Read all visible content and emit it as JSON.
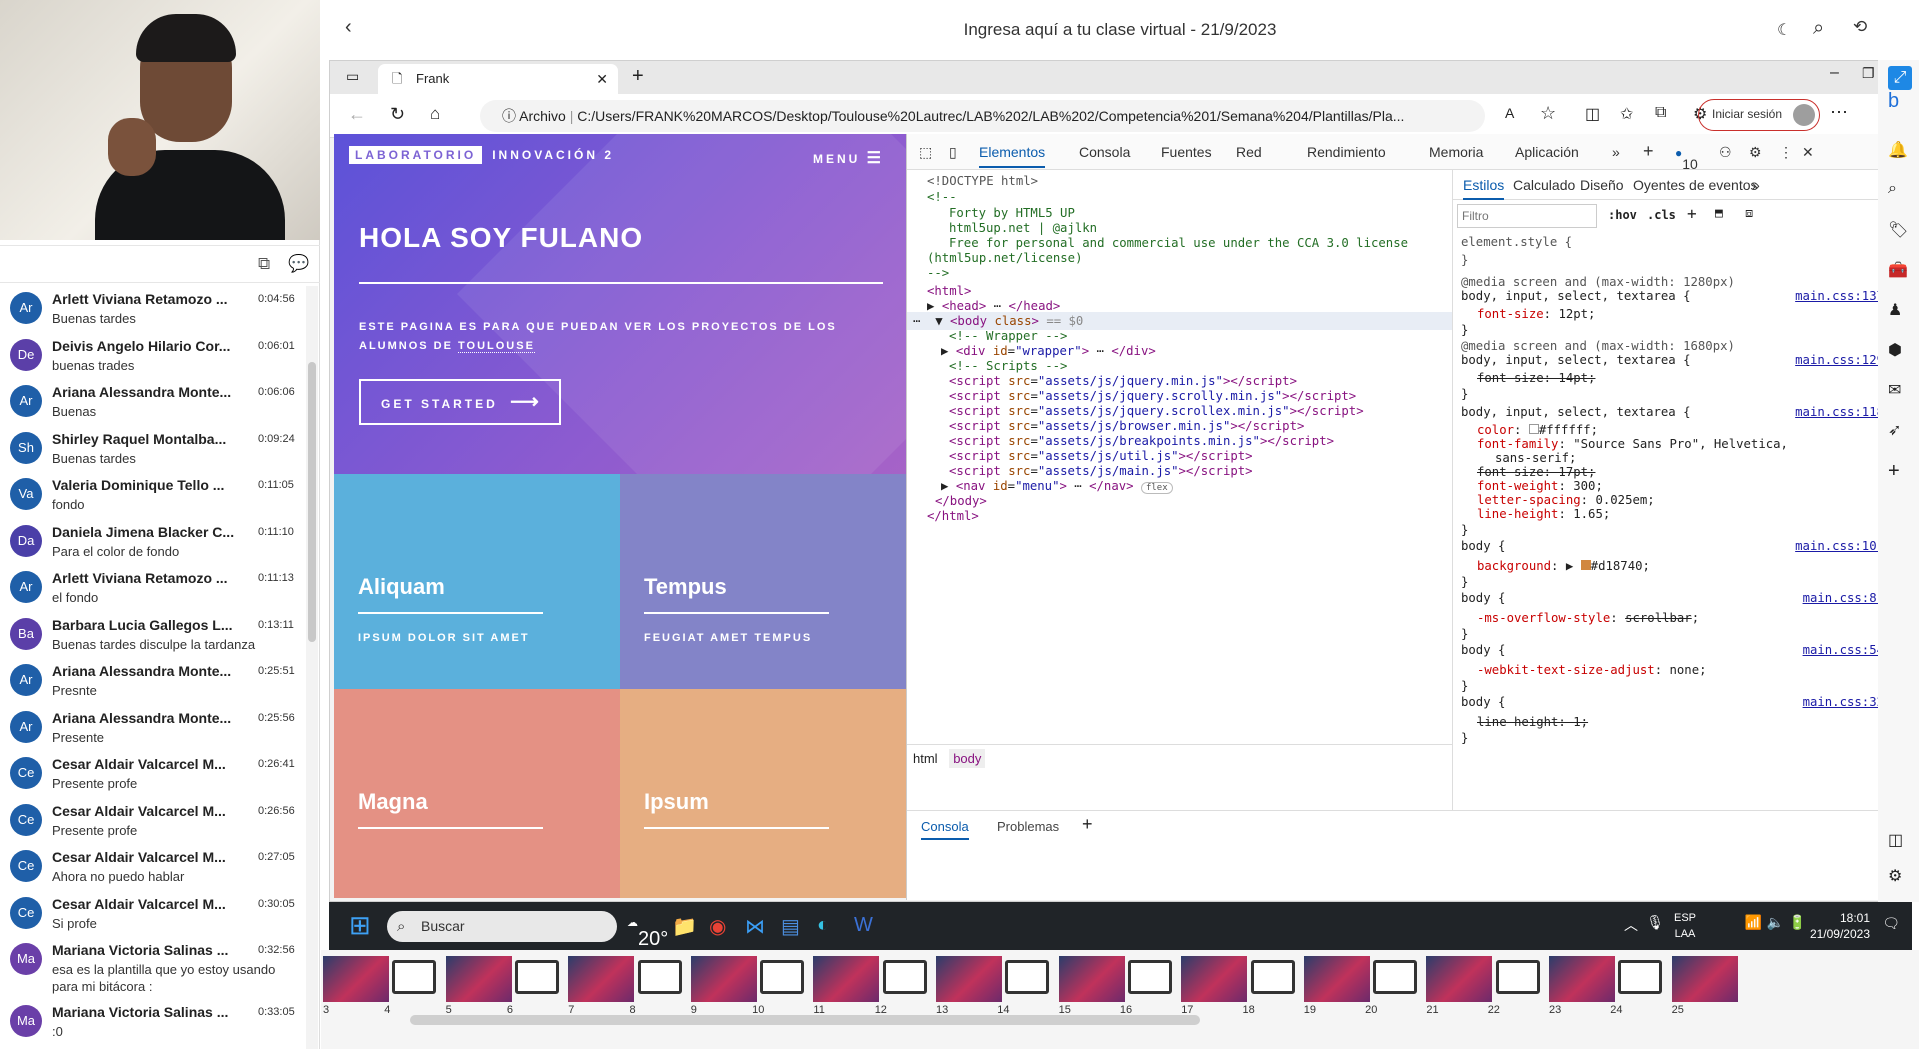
{
  "meeting": {
    "title": "Ingresa aquí a tu clase virtual - 21/9/2023"
  },
  "chat": {
    "messages": [
      {
        "initials": "Ar",
        "color": "#1f5fa8",
        "name": "Arlett Viviana Retamozo ...",
        "time": "0:04:56",
        "text": "Buenas tardes"
      },
      {
        "initials": "De",
        "color": "#5b3fa8",
        "name": "Deivis Angelo Hilario Cor...",
        "time": "0:06:01",
        "text": "buenas trades"
      },
      {
        "initials": "Ar",
        "color": "#1f5fa8",
        "name": "Ariana Alessandra Monte...",
        "time": "0:06:06",
        "text": "Buenas"
      },
      {
        "initials": "Sh",
        "color": "#1f5fa8",
        "name": "Shirley Raquel Montalba...",
        "time": "0:09:24",
        "text": "Buenas tardes"
      },
      {
        "initials": "Va",
        "color": "#1f5fa8",
        "name": "Valeria Dominique Tello ...",
        "time": "0:11:05",
        "text": "fondo"
      },
      {
        "initials": "Da",
        "color": "#4a3fa8",
        "name": "Daniela Jimena Blacker C...",
        "time": "0:11:10",
        "text": "Para el color de fondo"
      },
      {
        "initials": "Ar",
        "color": "#1f5fa8",
        "name": "Arlett Viviana Retamozo ...",
        "time": "0:11:13",
        "text": "el fondo"
      },
      {
        "initials": "Ba",
        "color": "#5b3fa8",
        "name": "Barbara Lucia Gallegos L...",
        "time": "0:13:11",
        "text": "Buenas tardes disculpe la tardanza"
      },
      {
        "initials": "Ar",
        "color": "#1f5fa8",
        "name": "Ariana Alessandra Monte...",
        "time": "0:25:51",
        "text": "Presnte"
      },
      {
        "initials": "Ar",
        "color": "#1f5fa8",
        "name": "Ariana Alessandra Monte...",
        "time": "0:25:56",
        "text": "Presente"
      },
      {
        "initials": "Ce",
        "color": "#1f5fa8",
        "name": "Cesar Aldair Valcarcel M...",
        "time": "0:26:41",
        "text": "Presente profe"
      },
      {
        "initials": "Ce",
        "color": "#1f5fa8",
        "name": "Cesar Aldair Valcarcel M...",
        "time": "0:26:56",
        "text": "Presente profe"
      },
      {
        "initials": "Ce",
        "color": "#1f5fa8",
        "name": "Cesar Aldair Valcarcel M...",
        "time": "0:27:05",
        "text": "Ahora no puedo hablar"
      },
      {
        "initials": "Ce",
        "color": "#1f5fa8",
        "name": "Cesar Aldair Valcarcel M...",
        "time": "0:30:05",
        "text": "Si profe"
      },
      {
        "initials": "Ma",
        "color": "#6a3fa8",
        "name": "Mariana Victoria Salinas ...",
        "time": "0:32:56",
        "text": "esa es la plantilla que yo estoy usando para mi bitácora :"
      },
      {
        "initials": "Ma",
        "color": "#6a3fa8",
        "name": "Mariana Victoria Salinas ...",
        "time": "0:33:05",
        "text": ":0"
      }
    ]
  },
  "browser": {
    "tab_title": "Frank",
    "archive_label": "Archivo",
    "url": "C:/Users/FRANK%20MARCOS/Desktop/Toulouse%20Lautrec/LAB%202/LAB%202/Competencia%201/Semana%204/Plantillas/Pla...",
    "signin": "Iniciar sesión"
  },
  "site": {
    "logo_box": "LABORATORIO",
    "logo_text": "INNOVACIÓN 2",
    "menu": "MENU",
    "hero_title": "HOLA SOY FULANO",
    "hero_sub_1": "ESTE PAGINA ES PARA QUE PUEDAN VER LOS PROYECTOS DE LOS",
    "hero_sub_2": "ALUMNOS DE",
    "hero_sub_link": "TOULOUSE",
    "cta": "GET STARTED",
    "tiles": [
      {
        "title": "Aliquam",
        "sub": "IPSUM DOLOR SIT AMET",
        "color": "#5bb0dc"
      },
      {
        "title": "Tempus",
        "sub": "FEUGIAT AMET TEMPUS",
        "color": "#8384c8"
      },
      {
        "title": "Magna",
        "sub": "",
        "color": "#e49184"
      },
      {
        "title": "Ipsum",
        "sub": "",
        "color": "#e6ae82"
      }
    ]
  },
  "devtools": {
    "tabs": [
      "Elementos",
      "Consola",
      "Fuentes",
      "Red",
      "Rendimiento",
      "Memoria",
      "Aplicación"
    ],
    "issues_count": "10",
    "styles_tabs": [
      "Estilos",
      "Calculado",
      "Diseño",
      "Oyentes de eventos"
    ],
    "filter_placeholder": "Filtro",
    "hov": ":hov",
    "cls": ".cls",
    "breadcrumb": [
      "html",
      "body"
    ],
    "drawer_tabs": [
      "Consola",
      "Problemas"
    ]
  },
  "taskbar": {
    "search": "Buscar",
    "lang1": "ESP",
    "lang2": "LAA",
    "time": "18:01",
    "date": "21/09/2023",
    "weather": "20°"
  },
  "thumbnails": {
    "numbers": [
      "3",
      "4",
      "5",
      "6",
      "7",
      "8",
      "9",
      "10",
      "11",
      "12",
      "13",
      "14",
      "15",
      "16",
      "17",
      "18",
      "19",
      "20",
      "21",
      "22",
      "23",
      "24",
      "25"
    ]
  }
}
